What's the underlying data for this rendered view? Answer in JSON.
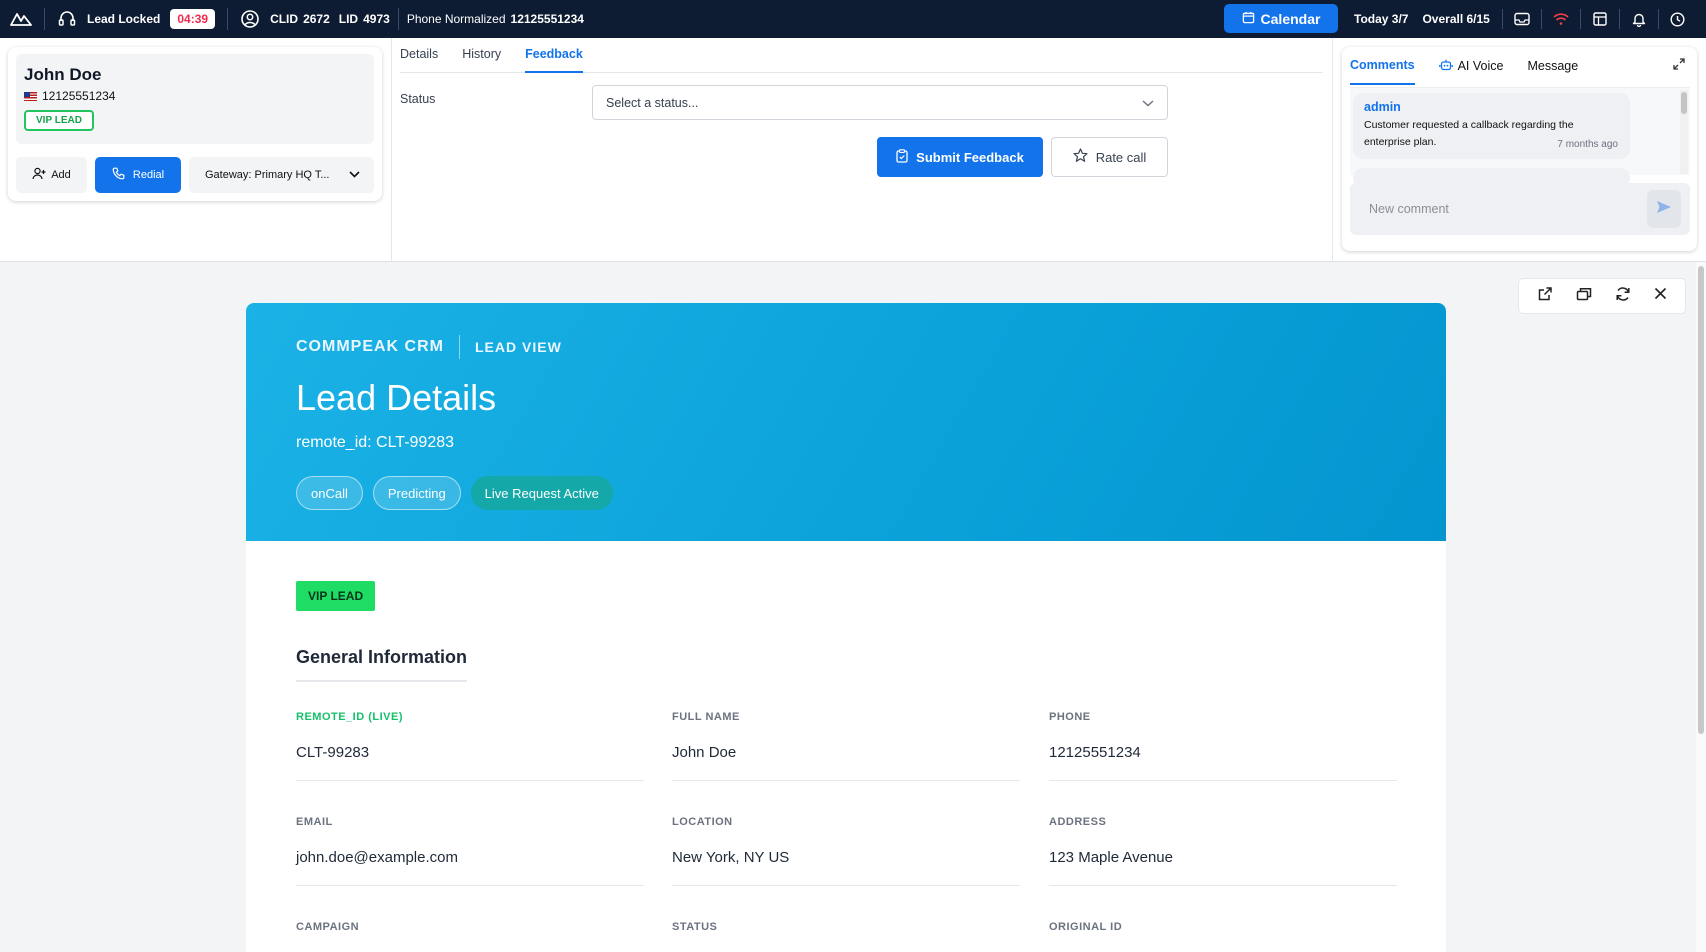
{
  "topbar": {
    "lead_locked": "Lead Locked",
    "timer": "04:39",
    "clid_label": "CLID",
    "clid_value": "2672",
    "lid_label": "LID",
    "lid_value": "4973",
    "phone_norm_label": "Phone Normalized",
    "phone_norm_value": "12125551234",
    "calendar_label": "Calendar",
    "today": "Today 3/7",
    "overall": "Overall 6/15"
  },
  "lead": {
    "name": "John Doe",
    "phone": "12125551234",
    "badge": "VIP LEAD",
    "add_label": "Add",
    "redial_label": "Redial",
    "gateway": "Gateway: Primary HQ T..."
  },
  "feedback": {
    "tabs": [
      "Details",
      "History",
      "Feedback"
    ],
    "active_tab": "Feedback",
    "status_label": "Status",
    "status_placeholder": "Select a status...",
    "submit_label": "Submit Feedback",
    "rate_label": "Rate call"
  },
  "comments": {
    "tabs": [
      "Comments",
      "AI Voice",
      "Message"
    ],
    "active_tab": "Comments",
    "items": [
      {
        "author": "admin",
        "text": "Customer requested a callback regarding the enterprise plan.",
        "time": "7 months ago"
      }
    ],
    "input_placeholder": "New comment"
  },
  "lead_view": {
    "brand": "COMMPEAK CRM",
    "section": "LEAD VIEW",
    "title": "Lead Details",
    "remote_id_line": "remote_id: CLT-99283",
    "pills": [
      "onCall",
      "Predicting",
      "Live Request Active"
    ],
    "vip_badge": "VIP LEAD",
    "general_title": "General Information",
    "fields": [
      {
        "label": "REMOTE_ID (LIVE)",
        "value": "CLT-99283"
      },
      {
        "label": "FULL NAME",
        "value": "John Doe"
      },
      {
        "label": "PHONE",
        "value": "12125551234"
      },
      {
        "label": "EMAIL",
        "value": "john.doe@example.com"
      },
      {
        "label": "LOCATION",
        "value": "New York, NY US"
      },
      {
        "label": "ADDRESS",
        "value": "123 Maple Avenue"
      },
      {
        "label": "CAMPAIGN",
        "value": ""
      },
      {
        "label": "STATUS",
        "value": ""
      },
      {
        "label": "ORIGINAL ID",
        "value": ""
      }
    ]
  },
  "colors": {
    "topbar_bg": "#0d1b33",
    "primary": "#1273eb",
    "timer_text": "#ef2b4f",
    "hero_bg": "#0aa1d9",
    "vip_green": "#1fdc64",
    "live_label": "#16c06a"
  },
  "icons": {
    "logo": "brand-logo-icon",
    "headset": "headset-icon",
    "user_circle": "user-circle-icon",
    "calendar": "calendar-icon",
    "inbox": "inbox-icon",
    "wifi": "wifi-icon",
    "layout": "layout-icon",
    "bell": "bell-icon",
    "clock": "clock-icon",
    "user_plus": "user-plus-icon",
    "phone": "phone-icon",
    "chevron": "chevron-down-icon",
    "clipboard": "clipboard-icon",
    "star": "star-icon",
    "robot": "robot-icon",
    "expand": "expand-icon",
    "send": "send-icon",
    "external": "external-link-icon",
    "window": "window-icon",
    "refresh": "refresh-icon",
    "close": "close-icon"
  }
}
